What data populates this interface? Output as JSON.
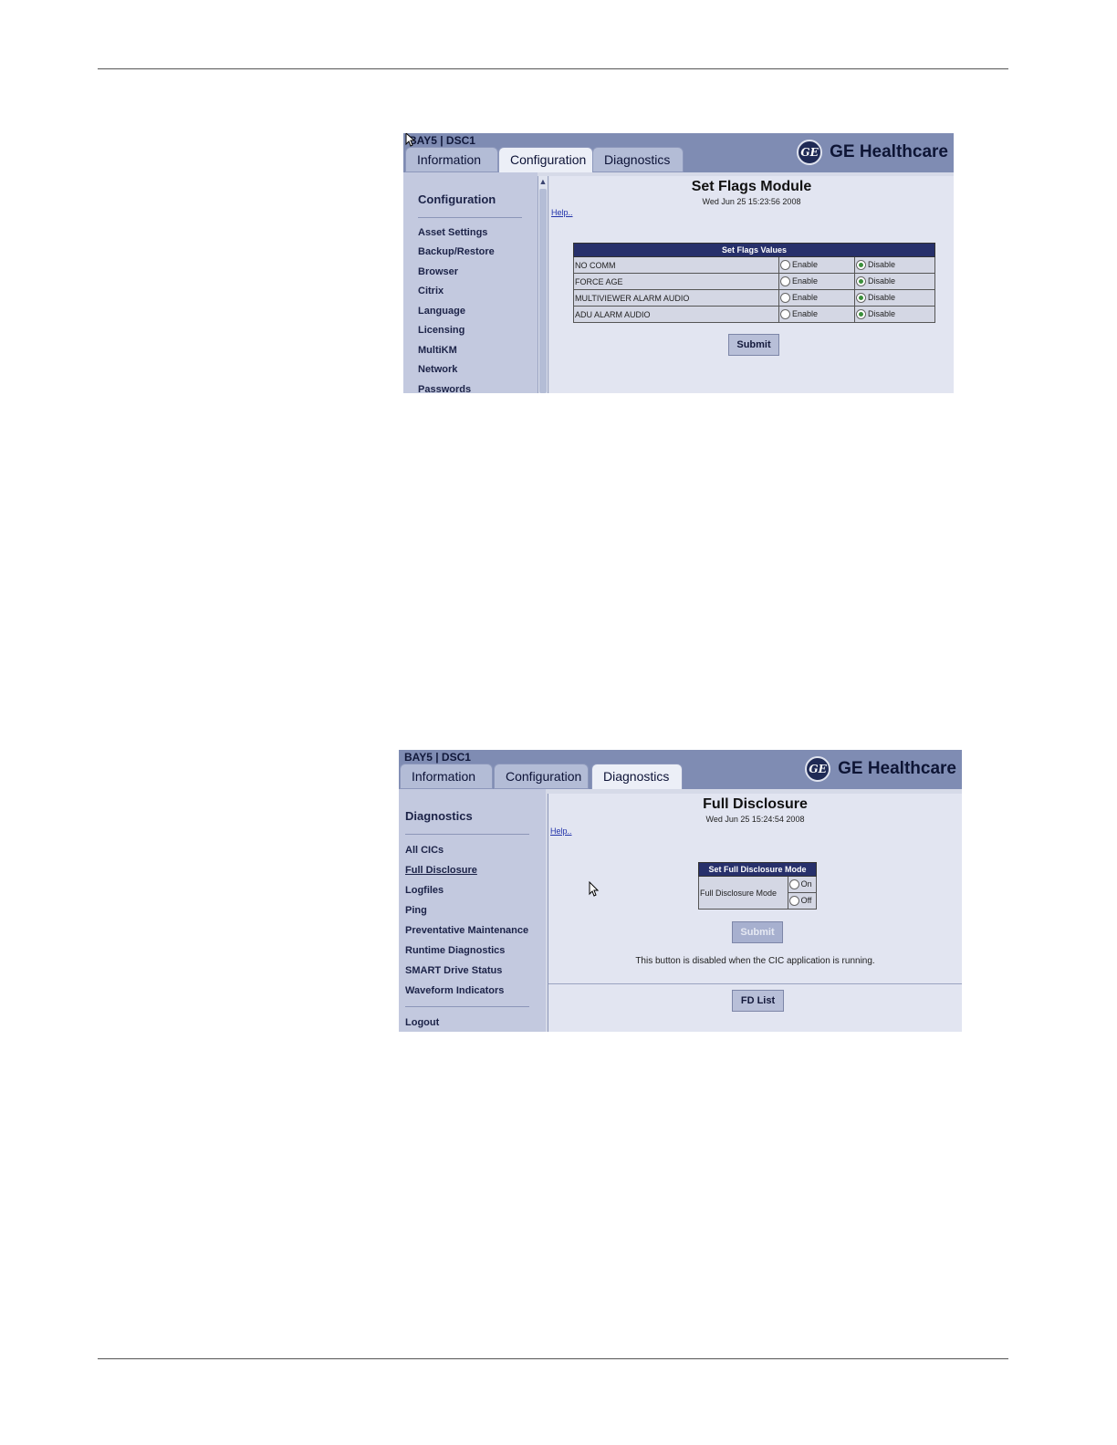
{
  "screenshot1": {
    "window_title": "BAY5 | DSC1",
    "tabs": [
      {
        "label": "Information",
        "active": false
      },
      {
        "label": "Configuration",
        "active": true
      },
      {
        "label": "Diagnostics",
        "active": false
      }
    ],
    "brand": {
      "logo_mark": "GE",
      "name": "GE Healthcare"
    },
    "sidebar": {
      "heading": "Configuration",
      "items": [
        "Asset Settings",
        "Backup/Restore",
        "Browser",
        "Citrix",
        "Language",
        "Licensing",
        "MultiKM",
        "Network",
        "Passwords"
      ]
    },
    "main": {
      "title": "Set Flags Module",
      "date": "Wed Jun 25 15:23:56 2008",
      "help": "Help..",
      "table": {
        "header": "Set Flags Values",
        "enable_label": "Enable",
        "disable_label": "Disable",
        "rows": [
          {
            "name": "NO COMM",
            "selected": "Disable"
          },
          {
            "name": "FORCE AGE",
            "selected": "Disable"
          },
          {
            "name": "MULTIVIEWER ALARM AUDIO",
            "selected": "Disable"
          },
          {
            "name": "ADU ALARM AUDIO",
            "selected": "Disable"
          }
        ]
      },
      "submit": "Submit"
    }
  },
  "screenshot2": {
    "window_title": "BAY5 | DSC1",
    "tabs": [
      {
        "label": "Information",
        "active": false
      },
      {
        "label": "Configuration",
        "active": false
      },
      {
        "label": "Diagnostics",
        "active": true
      }
    ],
    "brand": {
      "logo_mark": "GE",
      "name": "GE Healthcare"
    },
    "sidebar": {
      "heading": "Diagnostics",
      "items": [
        "All CICs",
        "Full Disclosure",
        "Logfiles",
        "Ping",
        "Preventative Maintenance",
        "Runtime Diagnostics",
        "SMART Drive Status",
        "Waveform Indicators"
      ],
      "logout": "Logout"
    },
    "main": {
      "title": "Full Disclosure",
      "date": "Wed Jun 25 15:24:54 2008",
      "help": "Help..",
      "mode_table": {
        "header": "Set Full Disclosure Mode",
        "label": "Full Disclosure Mode",
        "options": [
          "On",
          "Off"
        ]
      },
      "submit": "Submit",
      "note": "This button is disabled when the CIC application is running.",
      "fd_list": "FD List"
    }
  }
}
